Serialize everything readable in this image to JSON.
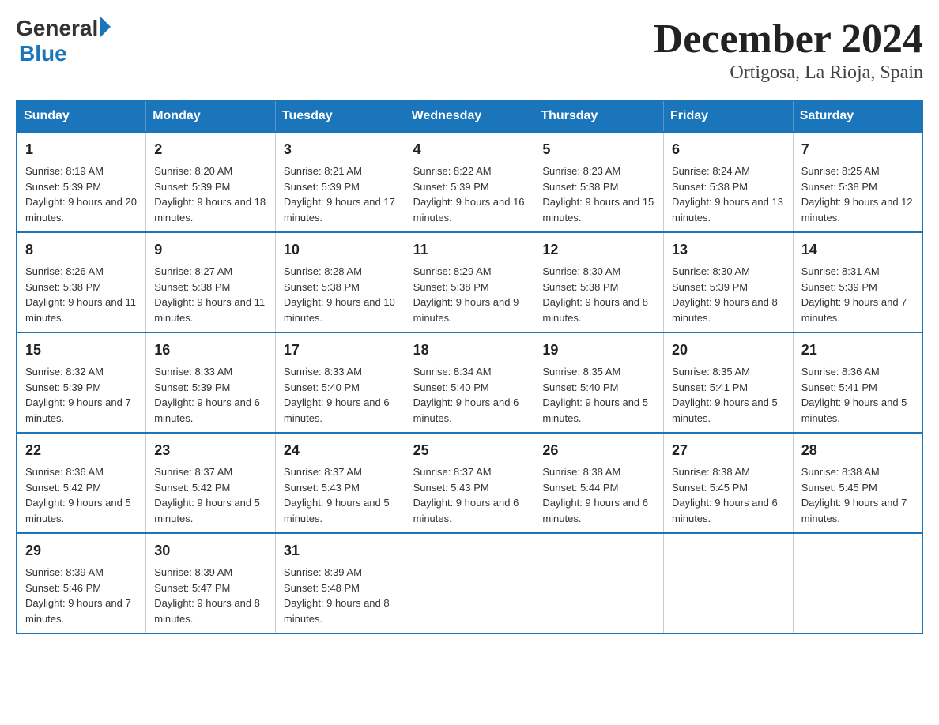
{
  "header": {
    "logo_general": "General",
    "logo_blue": "Blue",
    "title": "December 2024",
    "subtitle": "Ortigosa, La Rioja, Spain"
  },
  "days_of_week": [
    "Sunday",
    "Monday",
    "Tuesday",
    "Wednesday",
    "Thursday",
    "Friday",
    "Saturday"
  ],
  "weeks": [
    [
      {
        "day": "1",
        "sunrise": "Sunrise: 8:19 AM",
        "sunset": "Sunset: 5:39 PM",
        "daylight": "Daylight: 9 hours and 20 minutes."
      },
      {
        "day": "2",
        "sunrise": "Sunrise: 8:20 AM",
        "sunset": "Sunset: 5:39 PM",
        "daylight": "Daylight: 9 hours and 18 minutes."
      },
      {
        "day": "3",
        "sunrise": "Sunrise: 8:21 AM",
        "sunset": "Sunset: 5:39 PM",
        "daylight": "Daylight: 9 hours and 17 minutes."
      },
      {
        "day": "4",
        "sunrise": "Sunrise: 8:22 AM",
        "sunset": "Sunset: 5:39 PM",
        "daylight": "Daylight: 9 hours and 16 minutes."
      },
      {
        "day": "5",
        "sunrise": "Sunrise: 8:23 AM",
        "sunset": "Sunset: 5:38 PM",
        "daylight": "Daylight: 9 hours and 15 minutes."
      },
      {
        "day": "6",
        "sunrise": "Sunrise: 8:24 AM",
        "sunset": "Sunset: 5:38 PM",
        "daylight": "Daylight: 9 hours and 13 minutes."
      },
      {
        "day": "7",
        "sunrise": "Sunrise: 8:25 AM",
        "sunset": "Sunset: 5:38 PM",
        "daylight": "Daylight: 9 hours and 12 minutes."
      }
    ],
    [
      {
        "day": "8",
        "sunrise": "Sunrise: 8:26 AM",
        "sunset": "Sunset: 5:38 PM",
        "daylight": "Daylight: 9 hours and 11 minutes."
      },
      {
        "day": "9",
        "sunrise": "Sunrise: 8:27 AM",
        "sunset": "Sunset: 5:38 PM",
        "daylight": "Daylight: 9 hours and 11 minutes."
      },
      {
        "day": "10",
        "sunrise": "Sunrise: 8:28 AM",
        "sunset": "Sunset: 5:38 PM",
        "daylight": "Daylight: 9 hours and 10 minutes."
      },
      {
        "day": "11",
        "sunrise": "Sunrise: 8:29 AM",
        "sunset": "Sunset: 5:38 PM",
        "daylight": "Daylight: 9 hours and 9 minutes."
      },
      {
        "day": "12",
        "sunrise": "Sunrise: 8:30 AM",
        "sunset": "Sunset: 5:38 PM",
        "daylight": "Daylight: 9 hours and 8 minutes."
      },
      {
        "day": "13",
        "sunrise": "Sunrise: 8:30 AM",
        "sunset": "Sunset: 5:39 PM",
        "daylight": "Daylight: 9 hours and 8 minutes."
      },
      {
        "day": "14",
        "sunrise": "Sunrise: 8:31 AM",
        "sunset": "Sunset: 5:39 PM",
        "daylight": "Daylight: 9 hours and 7 minutes."
      }
    ],
    [
      {
        "day": "15",
        "sunrise": "Sunrise: 8:32 AM",
        "sunset": "Sunset: 5:39 PM",
        "daylight": "Daylight: 9 hours and 7 minutes."
      },
      {
        "day": "16",
        "sunrise": "Sunrise: 8:33 AM",
        "sunset": "Sunset: 5:39 PM",
        "daylight": "Daylight: 9 hours and 6 minutes."
      },
      {
        "day": "17",
        "sunrise": "Sunrise: 8:33 AM",
        "sunset": "Sunset: 5:40 PM",
        "daylight": "Daylight: 9 hours and 6 minutes."
      },
      {
        "day": "18",
        "sunrise": "Sunrise: 8:34 AM",
        "sunset": "Sunset: 5:40 PM",
        "daylight": "Daylight: 9 hours and 6 minutes."
      },
      {
        "day": "19",
        "sunrise": "Sunrise: 8:35 AM",
        "sunset": "Sunset: 5:40 PM",
        "daylight": "Daylight: 9 hours and 5 minutes."
      },
      {
        "day": "20",
        "sunrise": "Sunrise: 8:35 AM",
        "sunset": "Sunset: 5:41 PM",
        "daylight": "Daylight: 9 hours and 5 minutes."
      },
      {
        "day": "21",
        "sunrise": "Sunrise: 8:36 AM",
        "sunset": "Sunset: 5:41 PM",
        "daylight": "Daylight: 9 hours and 5 minutes."
      }
    ],
    [
      {
        "day": "22",
        "sunrise": "Sunrise: 8:36 AM",
        "sunset": "Sunset: 5:42 PM",
        "daylight": "Daylight: 9 hours and 5 minutes."
      },
      {
        "day": "23",
        "sunrise": "Sunrise: 8:37 AM",
        "sunset": "Sunset: 5:42 PM",
        "daylight": "Daylight: 9 hours and 5 minutes."
      },
      {
        "day": "24",
        "sunrise": "Sunrise: 8:37 AM",
        "sunset": "Sunset: 5:43 PM",
        "daylight": "Daylight: 9 hours and 5 minutes."
      },
      {
        "day": "25",
        "sunrise": "Sunrise: 8:37 AM",
        "sunset": "Sunset: 5:43 PM",
        "daylight": "Daylight: 9 hours and 6 minutes."
      },
      {
        "day": "26",
        "sunrise": "Sunrise: 8:38 AM",
        "sunset": "Sunset: 5:44 PM",
        "daylight": "Daylight: 9 hours and 6 minutes."
      },
      {
        "day": "27",
        "sunrise": "Sunrise: 8:38 AM",
        "sunset": "Sunset: 5:45 PM",
        "daylight": "Daylight: 9 hours and 6 minutes."
      },
      {
        "day": "28",
        "sunrise": "Sunrise: 8:38 AM",
        "sunset": "Sunset: 5:45 PM",
        "daylight": "Daylight: 9 hours and 7 minutes."
      }
    ],
    [
      {
        "day": "29",
        "sunrise": "Sunrise: 8:39 AM",
        "sunset": "Sunset: 5:46 PM",
        "daylight": "Daylight: 9 hours and 7 minutes."
      },
      {
        "day": "30",
        "sunrise": "Sunrise: 8:39 AM",
        "sunset": "Sunset: 5:47 PM",
        "daylight": "Daylight: 9 hours and 8 minutes."
      },
      {
        "day": "31",
        "sunrise": "Sunrise: 8:39 AM",
        "sunset": "Sunset: 5:48 PM",
        "daylight": "Daylight: 9 hours and 8 minutes."
      },
      null,
      null,
      null,
      null
    ]
  ]
}
